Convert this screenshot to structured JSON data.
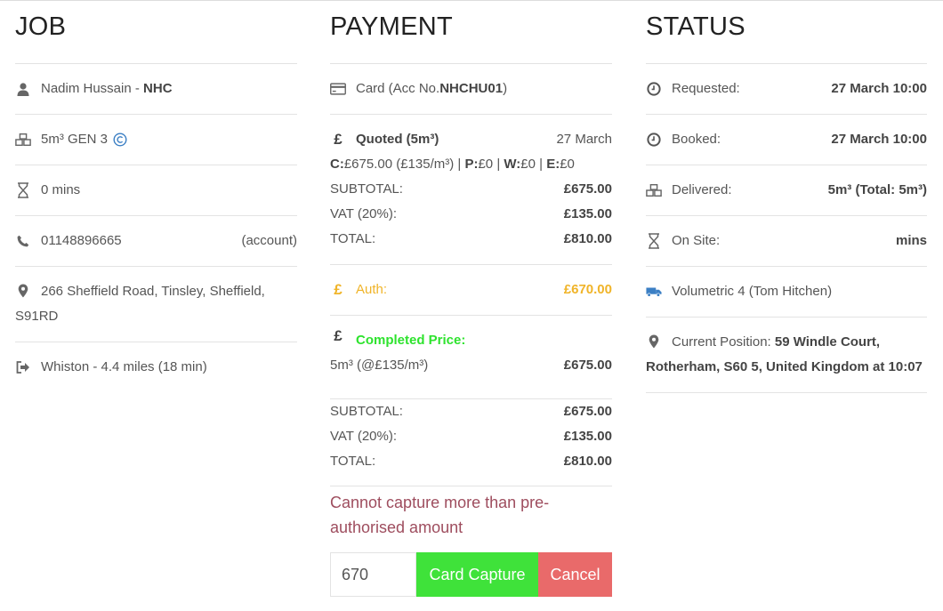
{
  "job": {
    "heading": "JOB",
    "customer_name": "Nadim Hussain - ",
    "customer_code": "NHC",
    "product": "5m³ GEN 3",
    "duration": "0 mins",
    "phone": "01148896665",
    "phone_tag": "(account)",
    "address": "266 Sheffield Road, Tinsley, Sheffield, S91RD",
    "route": "Whiston - 4.4 miles (18 min)"
  },
  "payment": {
    "heading": "PAYMENT",
    "card_prefix": "Card (Acc No. ",
    "account_no": "NHCHU01",
    "card_suffix": ")",
    "quoted_label": "Quoted (5m³)",
    "quoted_date": "27 March",
    "breakdown": {
      "c_label": "C:",
      "c_value": "£675.00 (£135/m³)",
      "p_label": "P:",
      "p_value": "£0",
      "w_label": "W:",
      "w_value": "£0",
      "e_label": "E:",
      "e_value": "£0"
    },
    "quote_totals": [
      {
        "label": "SUBTOTAL:",
        "value": "£675.00"
      },
      {
        "label": "VAT (20%):",
        "value": "£135.00"
      },
      {
        "label": "TOTAL:",
        "value": "£810.00"
      }
    ],
    "auth_label": "Auth:",
    "auth_value": "£670.00",
    "completed_label": "Completed Price:",
    "completed_line_label": "5m³ (@£135/m³)",
    "completed_line_value": "£675.00",
    "final_totals": [
      {
        "label": "SUBTOTAL:",
        "value": "£675.00"
      },
      {
        "label": "VAT (20%):",
        "value": "£135.00"
      },
      {
        "label": "TOTAL:",
        "value": "£810.00"
      }
    ],
    "error_message": "Cannot capture more than pre-authorised amount",
    "capture_amount": "670",
    "capture_button": "Card Capture",
    "cancel_button": "Cancel"
  },
  "status": {
    "heading": "STATUS",
    "requested_label": "Requested:",
    "requested_value": "27 March 10:00",
    "booked_label": "Booked:",
    "booked_value": "27 March 10:00",
    "delivered_label": "Delivered:",
    "delivered_value": "5m³ (Total: 5m³)",
    "onsite_label": "On Site:",
    "onsite_value": "mins",
    "vehicle": "Volumetric 4 (Tom Hitchen)",
    "position_label": "Current Position: ",
    "position_value": "59 Windle Court, Rotherham, S60 5, United Kingdom at 10:07"
  },
  "colors": {
    "auth": "#f0b429",
    "completed": "#2ee32e",
    "capture_button": "#3fe23a",
    "cancel_button": "#e96a6a",
    "error_text": "#9e4d5e",
    "icon_blue": "#3b7fc4"
  }
}
